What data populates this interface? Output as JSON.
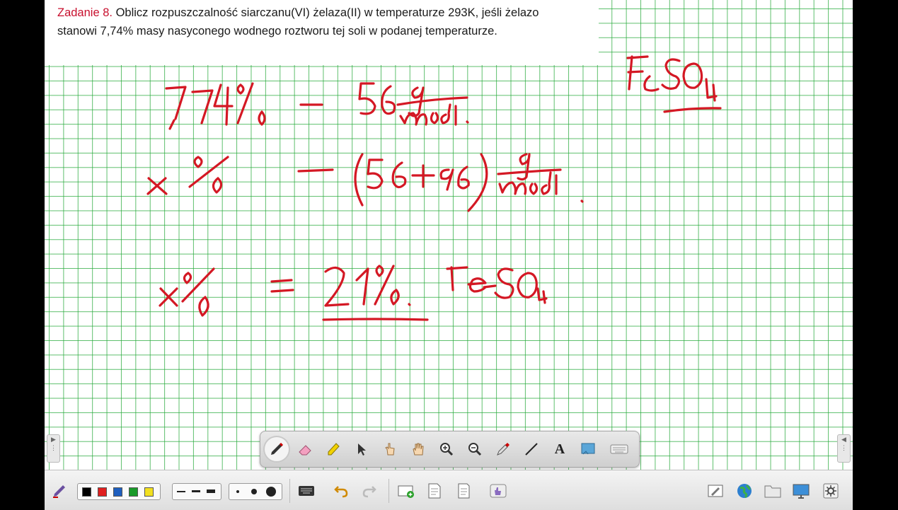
{
  "task": {
    "title": "Zadanie 8.",
    "body": "Oblicz rozpuszczalność siarczanu(VI) żelaza(II) w temperaturze 293K, jeśli żelazo stanowi 7,74% masy nasyconego wodnego roztworu tej soli w podanej temperaturze."
  },
  "colors": {
    "task_title": "#c8102e",
    "ink": "#d41824",
    "grid": "#28aa3c",
    "palette": [
      "#000000",
      "#e02020",
      "#1f5fbf",
      "#1a9a2a",
      "#f2e020"
    ]
  },
  "floating_toolbar": {
    "tools": [
      "pen-icon",
      "eraser-icon",
      "highlighter-icon",
      "select-arrow-icon",
      "pointer-hand-icon",
      "pan-hand-icon",
      "zoom-in-icon",
      "zoom-out-icon",
      "eyedropper-icon",
      "line-icon",
      "text-icon",
      "screen-capture-icon",
      "keyboard-icon"
    ],
    "text_tool_label": "A"
  },
  "bottom_toolbar": {
    "left": [
      "pen-settings-icon"
    ],
    "line_sizes": [
      "thin",
      "medium",
      "thick"
    ],
    "dot_sizes": [
      "small",
      "medium",
      "large"
    ],
    "actions": [
      "keyboard-icon",
      "undo-icon",
      "redo-icon",
      "add-page-icon",
      "page-icon",
      "page-list-icon",
      "gesture-icon"
    ],
    "right": [
      "edit-icon",
      "globe-icon",
      "folder-icon",
      "display-icon",
      "settings-icon"
    ]
  }
}
